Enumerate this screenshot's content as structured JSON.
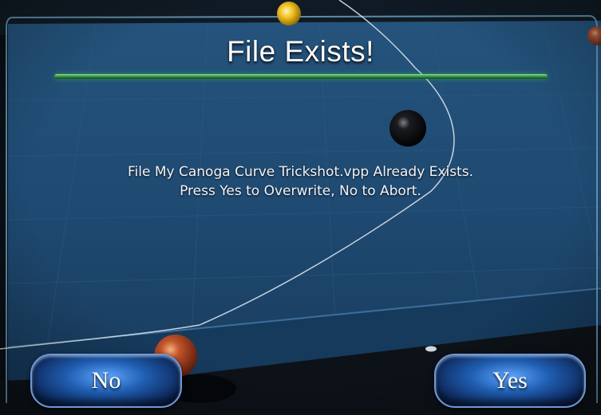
{
  "dialog": {
    "title": "File Exists!",
    "message_line1": "File My Canoga Curve Trickshot.vpp Already Exists.",
    "message_line2": "Press Yes to Overwrite, No to Abort."
  },
  "buttons": {
    "no_label": "No",
    "yes_label": "Yes"
  },
  "colors": {
    "table_felt": "#1f4a72",
    "title_bar": "#3d9a4a",
    "button_blue": "#1f5db0",
    "frame_border": "#6fa9c9"
  }
}
